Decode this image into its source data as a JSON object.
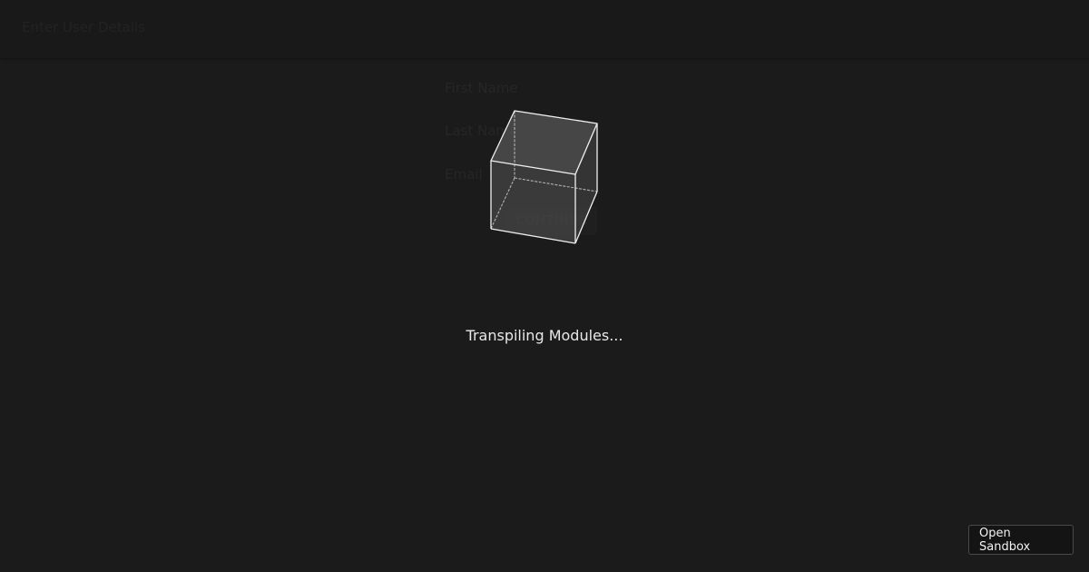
{
  "app": {
    "title": "Enter User Details"
  },
  "form": {
    "first_name_placeholder": "First Name",
    "last_name_placeholder": "Last Name",
    "email_placeholder": "Email",
    "continue_label": "CONTINUE"
  },
  "loader": {
    "icon": "cube-icon",
    "status": "Transpiling Modules..."
  },
  "sandbox": {
    "open_label": "Open Sandbox"
  }
}
